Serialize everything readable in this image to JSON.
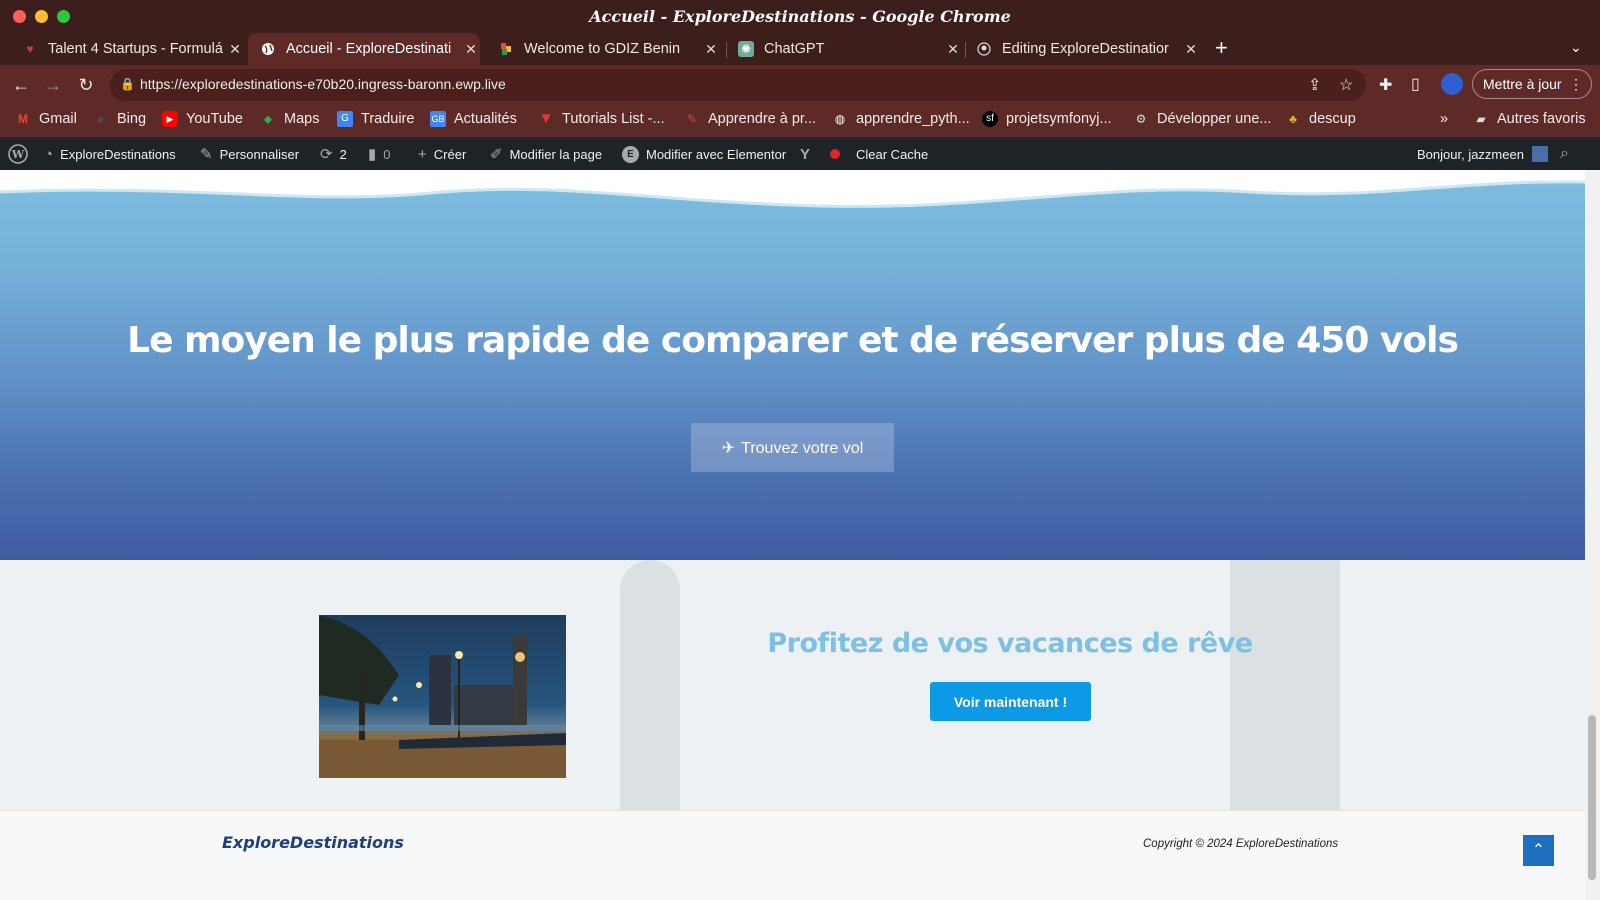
{
  "window": {
    "title": "Accueil - ExploreDestinations - Google Chrome"
  },
  "tabs": [
    {
      "label": "Talent 4 Startups - Formulá",
      "active": false
    },
    {
      "label": "Accueil - ExploreDestinati",
      "active": true
    },
    {
      "label": "Welcome to GDIZ Benin",
      "active": false
    },
    {
      "label": "ChatGPT",
      "active": false
    },
    {
      "label": "Editing ExploreDestinatior",
      "active": false
    }
  ],
  "toolbar": {
    "url_host": "https://exploredestinations-e70b20.ingress-baronn.ewp.live",
    "update_label": "Mettre à jour"
  },
  "bookmarks": [
    {
      "label": "Gmail",
      "icon": "gmail-icon"
    },
    {
      "label": "Bing",
      "icon": "bing-icon"
    },
    {
      "label": "YouTube",
      "icon": "youtube-icon"
    },
    {
      "label": "Maps",
      "icon": "maps-icon"
    },
    {
      "label": "Traduire",
      "icon": "translate-icon"
    },
    {
      "label": "Actualités",
      "icon": "news-icon"
    },
    {
      "label": "Tutorials List -...",
      "icon": "tutorials-icon"
    },
    {
      "label": "Apprendre à pr...",
      "icon": "learn-icon"
    },
    {
      "label": "apprendre_pyth...",
      "icon": "globe-icon"
    },
    {
      "label": "projetsymfonyj...",
      "icon": "symfony-icon"
    },
    {
      "label": "Développer une...",
      "icon": "dev-icon"
    },
    {
      "label": "descup",
      "icon": "descup-icon"
    }
  ],
  "bookmarks_other": "Autres favoris",
  "wpbar": {
    "site": "ExploreDestinations",
    "customize": "Personnaliser",
    "updates": "2",
    "comments": "0",
    "new": "Créer",
    "edit_page": "Modifier la page",
    "elementor": "Modifier avec Elementor",
    "clear_cache": "Clear Cache",
    "greeting": "Bonjour, jazzmeen"
  },
  "hero": {
    "heading": "Le moyen le plus rapide de comparer et de réserver plus de 450 vols",
    "button": "Trouvez votre vol"
  },
  "promo": {
    "heading": "Profitez de vos vacances de rêve",
    "button": "Voir maintenant !"
  },
  "footer": {
    "logo": "ExploreDestinations",
    "copyright": "Copyright © 2024 ExploreDestinations"
  },
  "colors": {
    "chrome_frame": "#3c1f1c",
    "toolbar": "#5e2a27",
    "wp_admin": "#1d2327",
    "promo_heading": "#7ec0e3",
    "cta_blue": "#0c9ae6"
  }
}
